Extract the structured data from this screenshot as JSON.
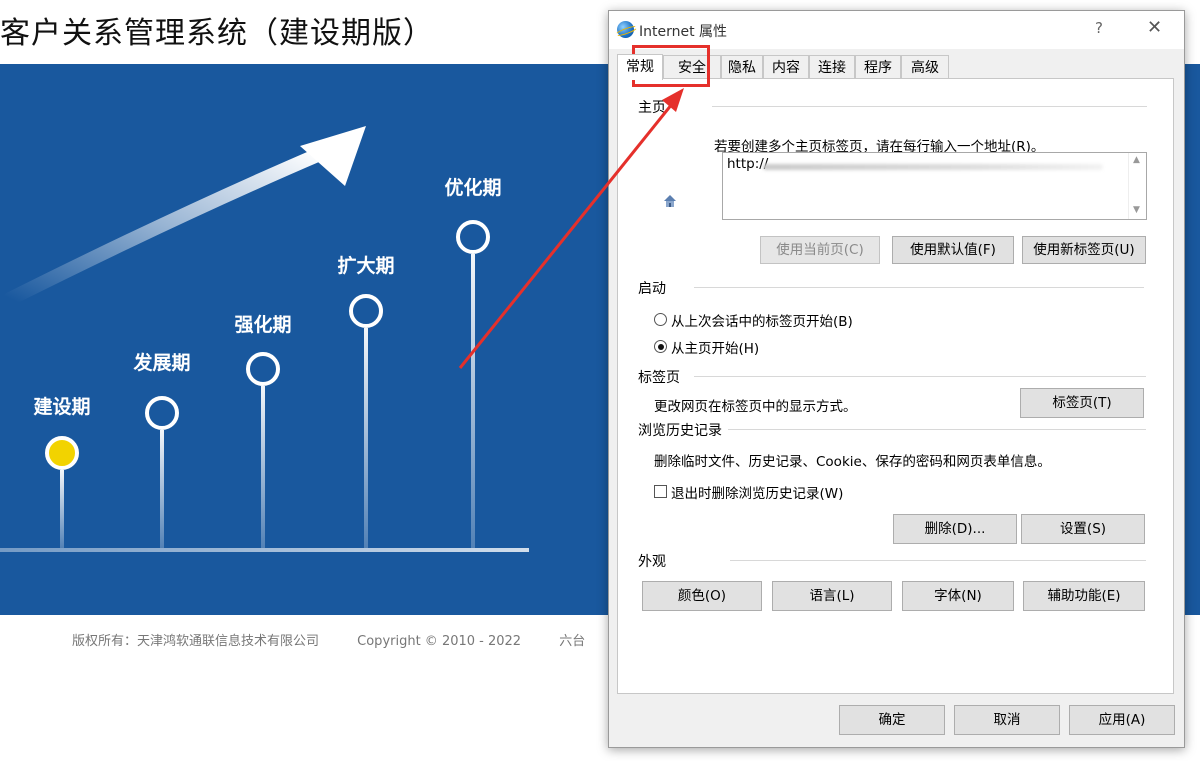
{
  "page": {
    "title": "客户关系管理系统（建设期版）",
    "stages": [
      "建设期",
      "发展期",
      "强化期",
      "扩大期",
      "优化期"
    ],
    "footer": {
      "company": "版权所有：天津鸿软通联信息技术有限公司",
      "copyright": "Copyright © 2010 - 2022",
      "partial": "六台"
    }
  },
  "dialog": {
    "title": "Internet 属性",
    "help_label": "?",
    "close_label": "✕",
    "tabs": [
      {
        "label": "常规",
        "active": true
      },
      {
        "label": "安全",
        "active": false
      },
      {
        "label": "隐私",
        "active": false
      },
      {
        "label": "内容",
        "active": false
      },
      {
        "label": "连接",
        "active": false
      },
      {
        "label": "程序",
        "active": false
      },
      {
        "label": "高级",
        "active": false
      }
    ],
    "home": {
      "heading": "主页",
      "icon": "home-page-icon",
      "instruction": "若要创建多个主页标签页，请在每行输入一个地址(R)。",
      "url_value": "http://",
      "btn_current": "使用当前页(C)",
      "btn_default": "使用默认值(F)",
      "btn_new_tab": "使用新标签页(U)"
    },
    "startup": {
      "heading": "启动",
      "option_last": "从上次会话中的标签页开始(B)",
      "option_home": "从主页开始(H)",
      "selected": "option_home"
    },
    "tabs_section": {
      "heading": "标签页",
      "desc": "更改网页在标签页中的显示方式。",
      "btn": "标签页(T)"
    },
    "history": {
      "heading": "浏览历史记录",
      "desc": "删除临时文件、历史记录、Cookie、保存的密码和网页表单信息。",
      "checkbox_label": "退出时删除浏览历史记录(W)",
      "checked": false,
      "btn_delete": "删除(D)...",
      "btn_settings": "设置(S)"
    },
    "appearance": {
      "heading": "外观",
      "btn_colors": "颜色(O)",
      "btn_language": "语言(L)",
      "btn_fonts": "字体(N)",
      "btn_accessibility": "辅助功能(E)"
    },
    "footer_buttons": {
      "ok": "确定",
      "cancel": "取消",
      "apply": "应用(A)"
    }
  },
  "annotation": {
    "color": "#e5302b",
    "highlighted_tab": "安全"
  },
  "colors": {
    "banner": "#19589e",
    "active_stage": "#f2d300"
  }
}
